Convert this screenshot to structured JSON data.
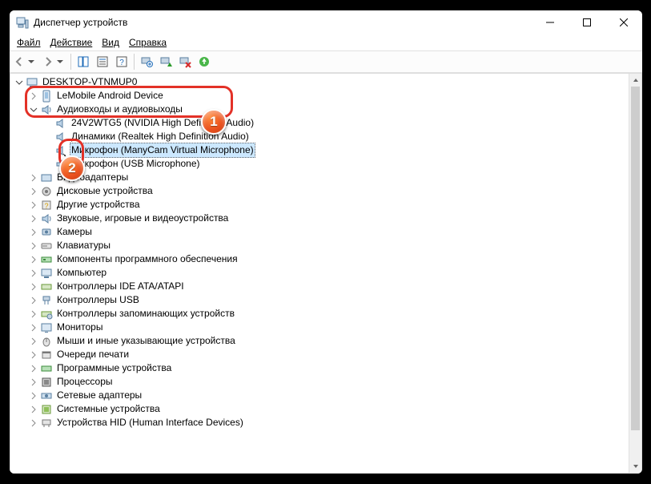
{
  "window": {
    "title": "Диспетчер устройств"
  },
  "menu": {
    "file": "Файл",
    "action": "Действие",
    "view": "Вид",
    "help": "Справка"
  },
  "tree": {
    "root": "DESKTOP-VTNMUP0",
    "android": "LeMobile Android Device",
    "audio": "Аудиовходы и аудиовыходы",
    "audio_items": [
      "24V2WTG5 (NVIDIA High Definition Audio)",
      "Динамики (Realtek High Definition Audio)",
      "Микрофон (ManyCam Virtual Microphone)",
      "Микрофон (USB Microphone)"
    ],
    "categories": [
      "Видеоадаптеры",
      "Дисковые устройства",
      "Другие устройства",
      "Звуковые, игровые и видеоустройства",
      "Камеры",
      "Клавиатуры",
      "Компоненты программного обеспечения",
      "Компьютер",
      "Контроллеры IDE ATA/ATAPI",
      "Контроллеры USB",
      "Контроллеры запоминающих устройств",
      "Мониторы",
      "Мыши и иные указывающие устройства",
      "Очереди печати",
      "Программные устройства",
      "Процессоры",
      "Сетевые адаптеры",
      "Системные устройства",
      "Устройства HID (Human Interface Devices)"
    ]
  },
  "callouts": {
    "one": "1",
    "two": "2"
  }
}
